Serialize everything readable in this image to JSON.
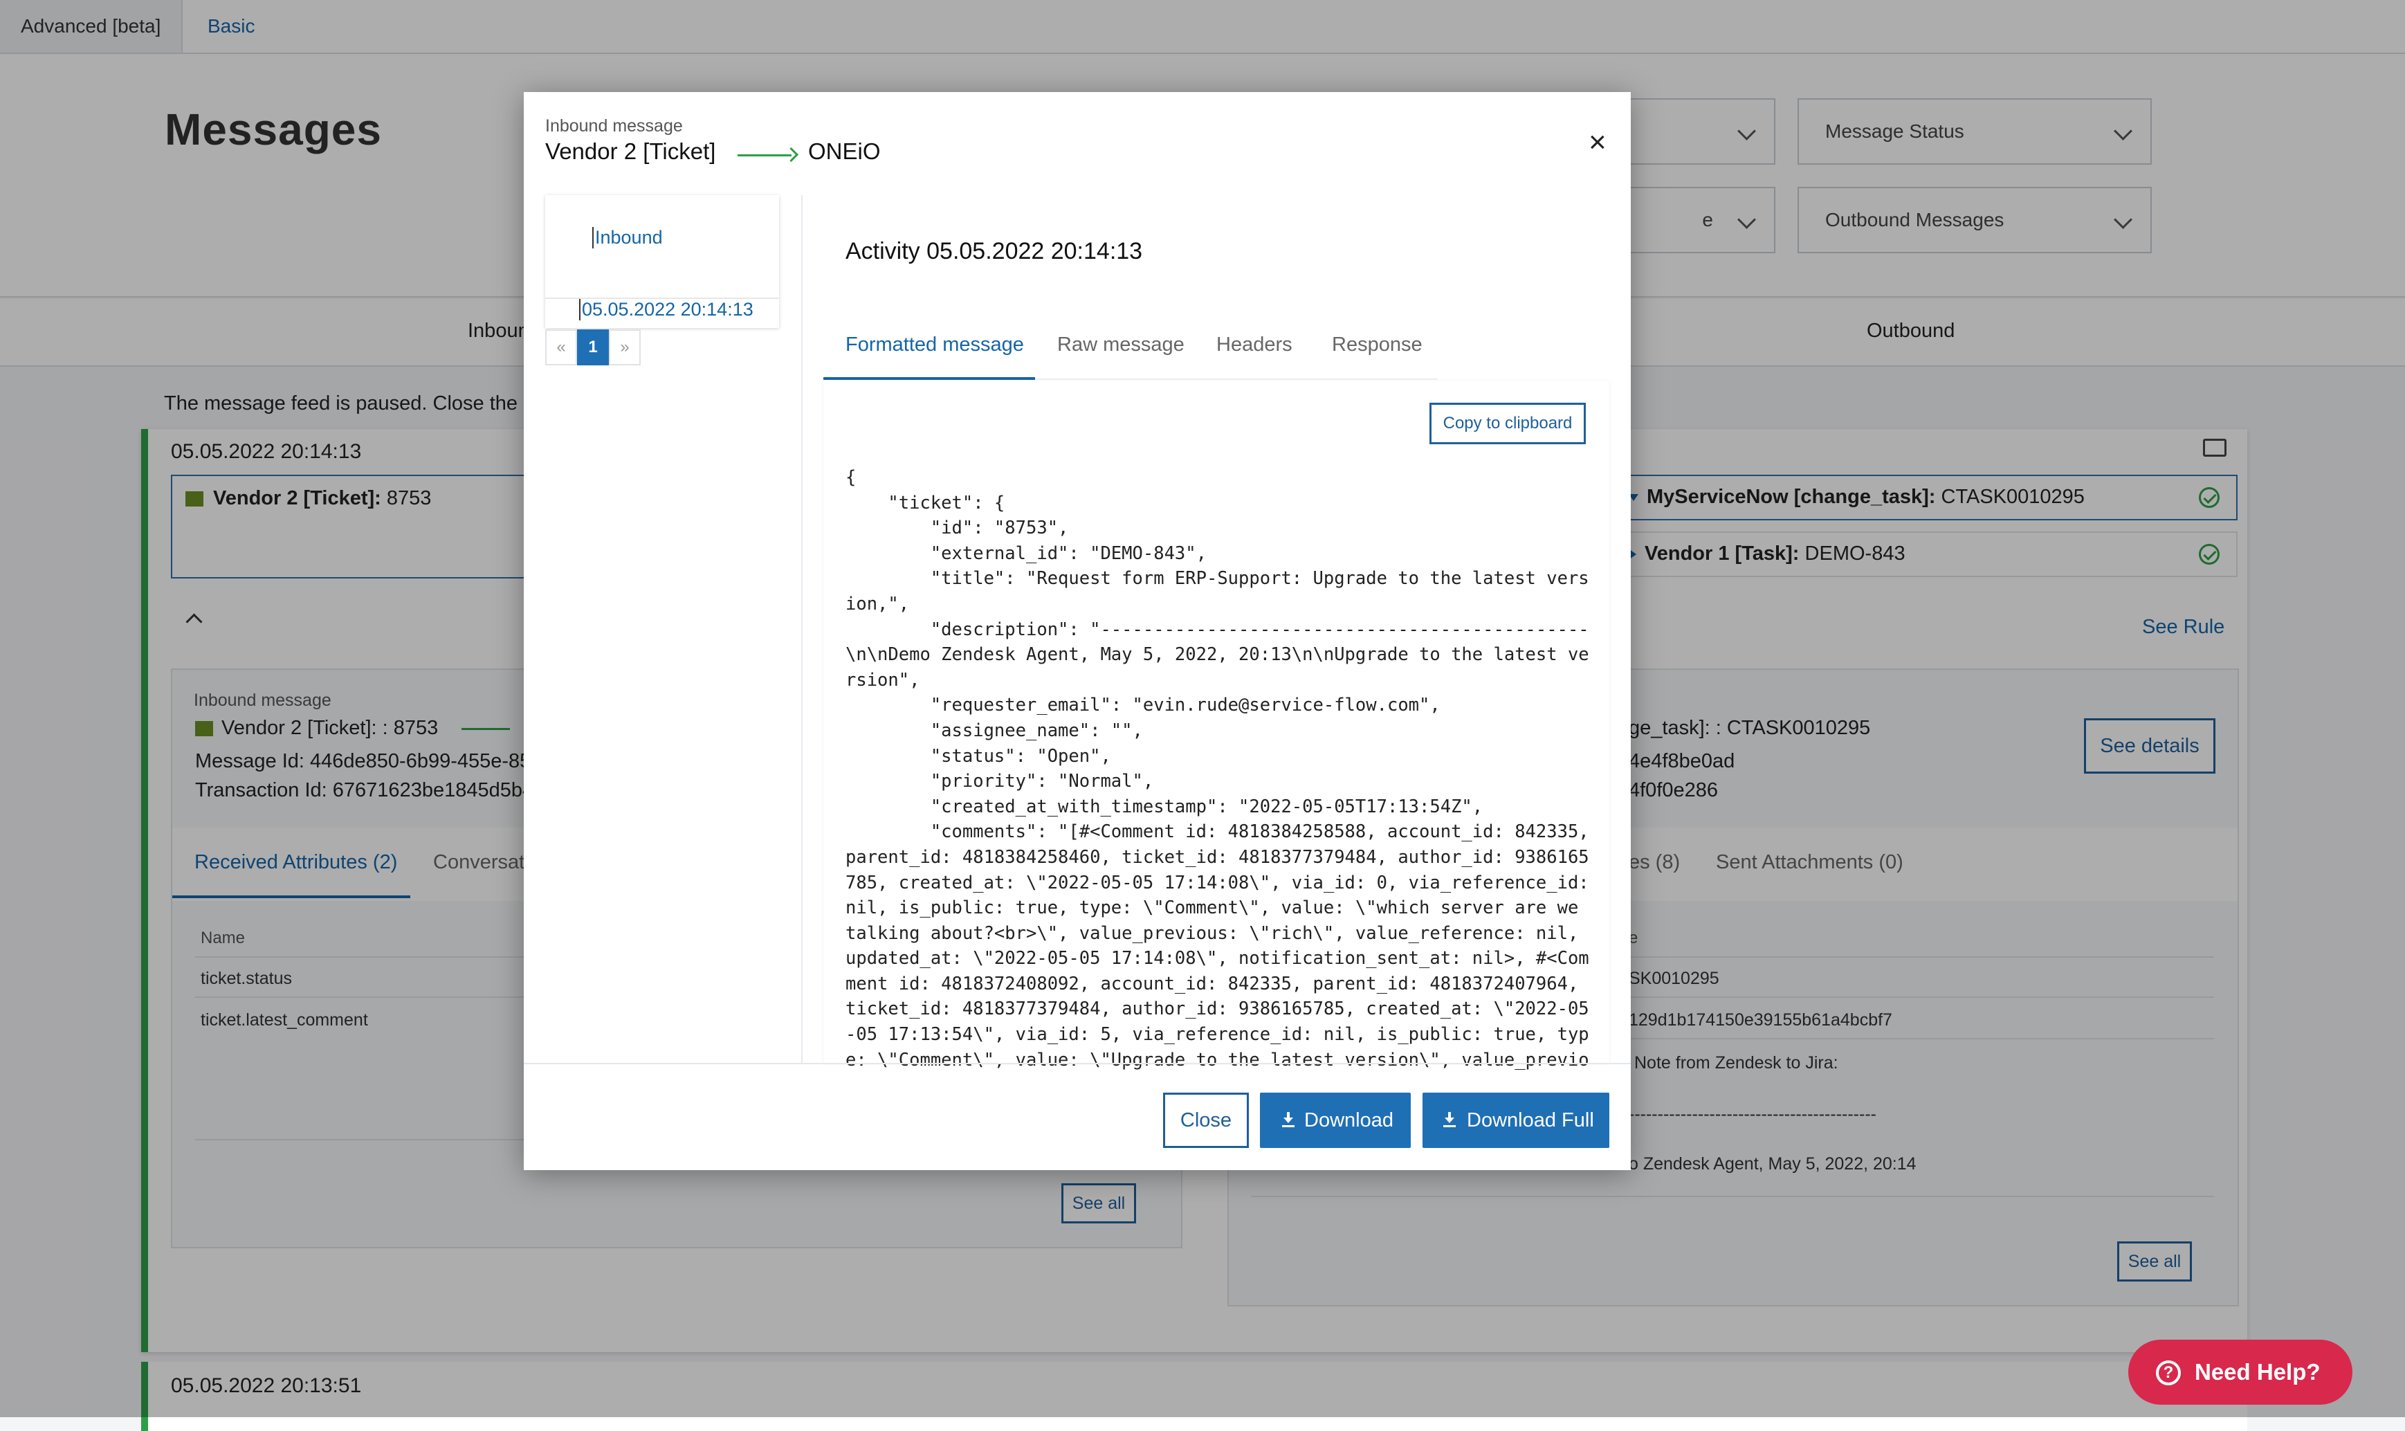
{
  "top_tabs": [
    {
      "label": "Advanced [beta]"
    },
    {
      "label": "Basic"
    }
  ],
  "page": {
    "title": "Messages",
    "filters": {
      "filter_a": "",
      "message_status": "Message Status",
      "filter_b_partial": "e",
      "outbound_messages": "Outbound Messages"
    },
    "column_inbound": "Inboun",
    "column_outbound": "Outbound",
    "paused_notice": "The message feed is paused. Close the mes"
  },
  "card": {
    "timestamp": "05.05.2022 20:14:13",
    "inbound_row": {
      "system": "Vendor 2 [Ticket]:",
      "id": "8753"
    },
    "outbound_rows": [
      {
        "system": "MyServiceNow [change_task]:",
        "id": "CTASK0010295"
      },
      {
        "system": "Vendor 1 [Task]:",
        "id": "DEMO-843"
      }
    ],
    "see_rule": "See Rule",
    "inbound_panel": {
      "sub": "Inbound message",
      "title": "Vendor 2 [Ticket]: : 8753",
      "message_id": "Message Id: 446de850-6b99-455e-85",
      "transaction_id": "Transaction Id: 67671623be1845d5b4",
      "tabs": [
        "Received Attributes (2)",
        "Conversati"
      ],
      "table_header": "Name",
      "rows": [
        "ticket.status",
        "ticket.latest_comment"
      ],
      "see_all": "See all"
    },
    "outbound_panel": {
      "title": "ge_task]: : CTASK0010295",
      "line1": "4e4f8be0ad",
      "line2": "4f0f0e286",
      "see_details": "See details",
      "tabs": [
        "es (8)",
        "Sent Attachments (0)"
      ],
      "table_header": "e",
      "cells": [
        "SK0010295",
        "129d1b174150e39155b61a4bcbf7",
        "Note from Zendesk to Jira:",
        "-------------------------------------------",
        "o Zendesk Agent, May 5, 2022, 20:14"
      ],
      "see_all": "See all"
    },
    "next_timestamp": "05.05.2022 20:13:51"
  },
  "help_button": "Need Help?",
  "modal": {
    "sub": "Inbound message",
    "source": "Vendor 2 [Ticket]",
    "target": "ONEiO",
    "close_symbol": "×",
    "side": {
      "inbound_link": "Inbound",
      "date_link": "05.05.2022 20:14:13",
      "pagination": {
        "prev": "«",
        "current": "1",
        "next": "»"
      }
    },
    "activity_title": "Activity 05.05.2022 20:14:13",
    "tabs": [
      {
        "label": "Formatted message"
      },
      {
        "label": "Raw message"
      },
      {
        "label": "Headers"
      },
      {
        "label": "Response"
      }
    ],
    "copy_button": "Copy to clipboard",
    "code": "{\n    \"ticket\": {\n        \"id\": \"8753\",\n        \"external_id\": \"DEMO-843\",\n        \"title\": \"Request form ERP-Support: Upgrade to the latest vers\nion,\",\n        \"description\": \"----------------------------------------------\n\\n\\nDemo Zendesk Agent, May 5, 2022, 20:13\\n\\nUpgrade to the latest ve\nrsion\",\n        \"requester_email\": \"evin.rude@service-flow.com\",\n        \"assignee_name\": \"\",\n        \"status\": \"Open\",\n        \"priority\": \"Normal\",\n        \"created_at_with_timestamp\": \"2022-05-05T17:13:54Z\",\n        \"comments\": \"[#<Comment id: 4818384258588, account_id: 842335,\nparent_id: 4818384258460, ticket_id: 4818377379484, author_id: 9386165\n785, created_at: \\\"2022-05-05 17:14:08\\\", via_id: 0, via_reference_id:\nnil, is_public: true, type: \\\"Comment\\\", value: \\\"which server are we\ntalking about?<br>\\\", value_previous: \\\"rich\\\", value_reference: nil,\nupdated_at: \\\"2022-05-05 17:14:08\\\", notification_sent_at: nil>, #<Com\nment id: 4818372408092, account_id: 842335, parent_id: 4818372407964,\nticket_id: 4818377379484, author_id: 9386165785, created_at: \\\"2022-05\n-05 17:13:54\\\", via_id: 5, via_reference_id: nil, is_public: true, typ\ne: \\\"Comment\\\", value: \\\"Upgrade to the latest version\\\", value_previo",
    "footer": {
      "close": "Close",
      "download": "Download",
      "download_full": "Download Full"
    }
  },
  "colors": {
    "accent": "#1f6fb5",
    "success": "#2e9e49",
    "help": "#d8284c"
  }
}
